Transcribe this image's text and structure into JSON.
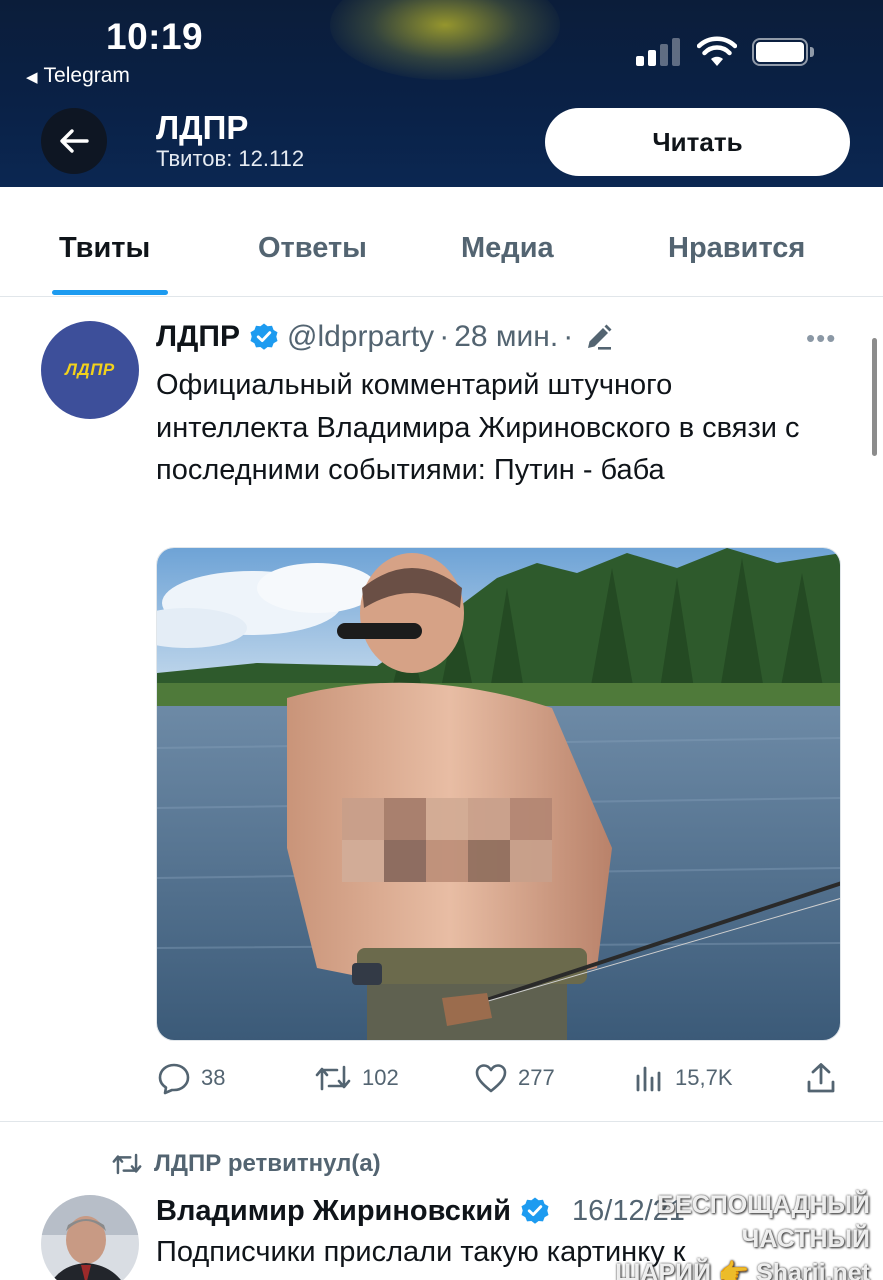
{
  "status_bar": {
    "time": "10:19",
    "back_app": "Telegram"
  },
  "header": {
    "name": "ЛДПР",
    "tweet_count": "Твитов: 12.112",
    "follow_label": "Читать"
  },
  "tabs": [
    {
      "label": "Твиты",
      "active": true
    },
    {
      "label": "Ответы",
      "active": false
    },
    {
      "label": "Медиа",
      "active": false
    },
    {
      "label": "Нравится",
      "active": false
    }
  ],
  "tweet1": {
    "avatar_text": "ЛДПР",
    "author": "ЛДПР",
    "handle": "@ldprparty",
    "dot": "·",
    "time": "28 мин.",
    "more": "•••",
    "text": "Официальный комментарий штучного интеллекта Владимира Жириновского в связи с последними событиями: Путин - баба",
    "stats": {
      "replies": "38",
      "retweets": "102",
      "likes": "277",
      "views": "15,7K"
    }
  },
  "tweet2": {
    "retweeted_by": "ЛДПР ретвитнул(а)",
    "author": "Владимир Жириновский",
    "time": "16/12/21",
    "text": "Подписчики прислали такую картинку к"
  },
  "watermark": {
    "line1": "БЕСПОЩАДНЫЙ ЧАСТНЫЙ",
    "line2": "ШАРИЙ 👉 Sharij.net"
  },
  "colors": {
    "header_bg": "#0b2146",
    "accent": "#1d9bf0",
    "secondary_text": "#536471",
    "ldpr_avatar_bg": "#3d4f9a",
    "ldpr_avatar_text": "#f2d21c"
  }
}
